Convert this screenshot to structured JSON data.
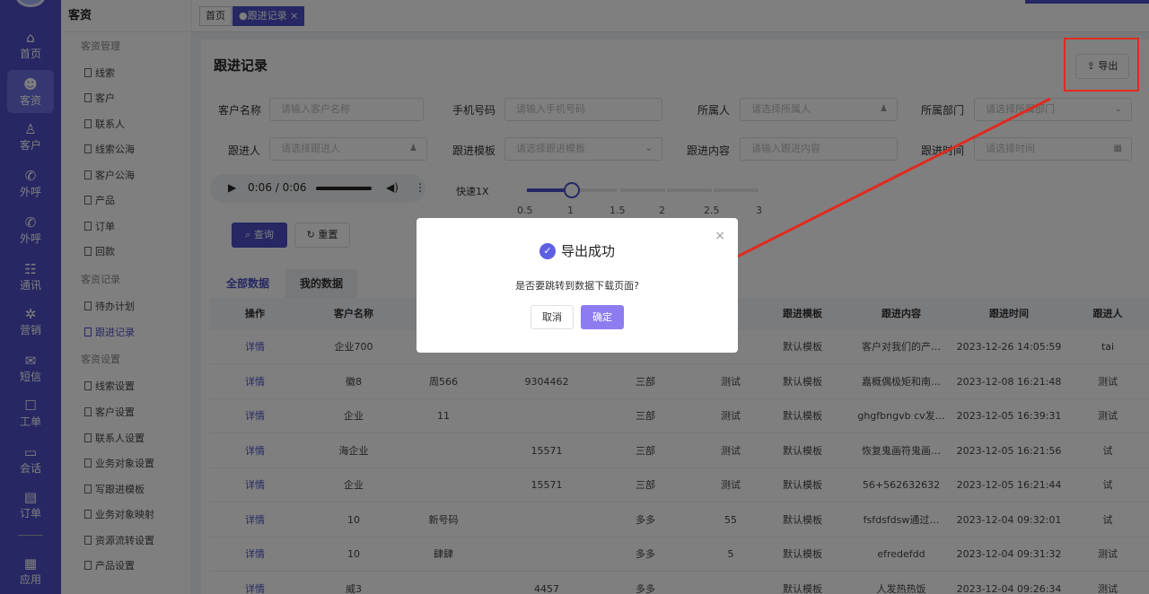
{
  "rail": [
    {
      "icon": "⌂",
      "label": "首页",
      "name": "rail-home"
    },
    {
      "icon": "☻",
      "label": "客资",
      "name": "rail-leads"
    },
    {
      "icon": "♙",
      "label": "客户",
      "name": "rail-customers"
    },
    {
      "icon": "✆",
      "label": "外呼",
      "name": "rail-outbound-call"
    },
    {
      "icon": "✆",
      "label": "外呼",
      "name": "rail-outbound-call-2"
    },
    {
      "icon": "☷",
      "label": "通讯",
      "name": "rail-contacts"
    },
    {
      "icon": "✲",
      "label": "营销",
      "name": "rail-marketing"
    },
    {
      "icon": "✉",
      "label": "短信",
      "name": "rail-sms"
    },
    {
      "icon": "☐",
      "label": "工单",
      "name": "rail-tickets"
    },
    {
      "icon": "▭",
      "label": "会话",
      "name": "rail-sessions"
    },
    {
      "icon": "▤",
      "label": "订单",
      "name": "rail-orders"
    },
    {
      "icon": "▦",
      "label": "应用",
      "name": "rail-apps"
    }
  ],
  "sidebar": {
    "title": "客资",
    "sections": [
      "客资管理",
      "客资记录",
      "客资设置"
    ],
    "items": [
      "线索",
      "客户",
      "联系人",
      "线索公海",
      "客户公海",
      "产品",
      "订单",
      "回款",
      "待办计划",
      "跟进记录",
      "线索设置",
      "客户设置",
      "联系人设置",
      "业务对象设置",
      "写跟进模板",
      "业务对象映射",
      "资源流转设置",
      "产品设置"
    ]
  },
  "tags": {
    "home": "首页",
    "current": "●跟进记录 ×"
  },
  "page": {
    "title": "跟进记录",
    "export": "导出"
  },
  "filters": {
    "customer_name": {
      "label": "客户名称",
      "placeholder": "请输入客户名称"
    },
    "phone": {
      "label": "手机号码",
      "placeholder": "请输入手机号码"
    },
    "owner": {
      "label": "所属人",
      "placeholder": "请选择所属人"
    },
    "dept": {
      "label": "所属部门",
      "placeholder": "请选择所属部门"
    },
    "follower": {
      "label": "跟进人",
      "placeholder": "请选择跟进人"
    },
    "template": {
      "label": "跟进模板",
      "placeholder": "请选择跟进模板"
    },
    "content": {
      "label": "跟进内容",
      "placeholder": "请输入跟进内容"
    },
    "time": {
      "label": "跟进时间",
      "placeholder": "请选择时间"
    }
  },
  "audio": {
    "time": "0:06 / 0:06",
    "play": "▶",
    "volume": "◀)",
    "more": "⋮"
  },
  "speed": {
    "label": "快速1X",
    "value": "1",
    "ticks": [
      "0.5",
      "1",
      "1.5",
      "2",
      "2.5",
      "3"
    ]
  },
  "actions": {
    "query": "⌕ 查询",
    "reset": "↻ 重置"
  },
  "tabs": {
    "all": "全部数据",
    "mine": "我的数据"
  },
  "table": {
    "headers": {
      "op": "操作",
      "name": "客户名称",
      "template": "跟进模板",
      "content": "跟进内容",
      "time": "跟进时间",
      "person": "跟进人"
    },
    "rows": [
      {
        "op": "详情",
        "name": "企业700",
        "c3": "",
        "c4": "",
        "c5": "",
        "c6": "",
        "template": "默认模板",
        "content": "客户对我们的产…",
        "time": "2023-12-26 14:05:59",
        "person": "tai"
      },
      {
        "op": "详情",
        "name": "徽8",
        "c3": "周566",
        "c4": "9304462",
        "c5": "三部",
        "c6": "测试",
        "template": "默认模板",
        "content": "嘉概偶极矩和南…",
        "time": "2023-12-08 16:21:48",
        "person": "测试"
      },
      {
        "op": "详情",
        "name": "企业",
        "c3": "11",
        "c4": "",
        "c5": "三部",
        "c6": "测试",
        "template": "默认模板",
        "content": "ghgfbngvb cv发…",
        "time": "2023-12-05 16:39:31",
        "person": "测试"
      },
      {
        "op": "详情",
        "name": "海企业",
        "c3": "",
        "c4": "15571",
        "c5": "三部",
        "c6": "测试",
        "template": "默认模板",
        "content": "恢复鬼画符鬼画…",
        "time": "2023-12-05 16:21:56",
        "person": "试"
      },
      {
        "op": "详情",
        "name": "企业",
        "c3": "",
        "c4": "15571",
        "c5": "三部",
        "c6": "测试",
        "template": "默认模板",
        "content": "56+562632632",
        "time": "2023-12-05 16:21:44",
        "person": "试"
      },
      {
        "op": "详情",
        "name": "10",
        "c3": "新号码",
        "c4": "",
        "c5": "多多",
        "c6": "55",
        "template": "默认模板",
        "content": "fsfdsfdsw通过…",
        "time": "2023-12-04 09:32:01",
        "person": "试"
      },
      {
        "op": "详情",
        "name": "10",
        "c3": "肆肆",
        "c4": "",
        "c5": "多多",
        "c6": "5",
        "template": "默认模板",
        "content": "efredefdd",
        "time": "2023-12-04 09:31:32",
        "person": "测试"
      },
      {
        "op": "详情",
        "name": "威3",
        "c3": "",
        "c4": "4457",
        "c5": "多多",
        "c6": "",
        "template": "默认模板",
        "content": "人发热热饭",
        "time": "2023-12-04 09:26:34",
        "person": "测试"
      }
    ]
  },
  "modal": {
    "title": "导出成功",
    "message": "是否要跳转到数据下载页面?",
    "cancel": "取消",
    "ok": "确定",
    "close": "×",
    "check": "✓"
  },
  "colors": {
    "accent": "#4c4ec7",
    "annotation": "#e02a1f"
  }
}
